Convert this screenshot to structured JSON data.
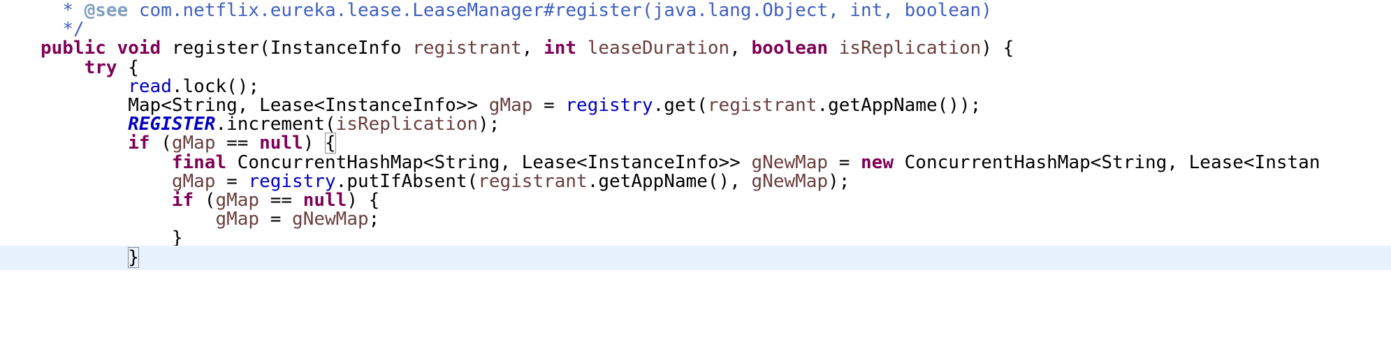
{
  "editor": {
    "lines": [
      {
        "indent": "  ",
        "highlight": false,
        "tokens": [
          {
            "t": "* ",
            "c": "cmt"
          },
          {
            "t": "@see",
            "c": "tag"
          },
          {
            "t": " com.netflix.eureka.lease.LeaseManager#register(java.lang.Object, int, boolean)",
            "c": "cmt"
          }
        ]
      },
      {
        "indent": "  ",
        "highlight": false,
        "tokens": [
          {
            "t": "*/",
            "c": "cmt"
          }
        ]
      },
      {
        "indent": "",
        "highlight": false,
        "tokens": [
          {
            "t": "public",
            "c": "kw"
          },
          {
            "t": " ",
            "c": ""
          },
          {
            "t": "void",
            "c": "kw"
          },
          {
            "t": " register(InstanceInfo ",
            "c": ""
          },
          {
            "t": "registrant",
            "c": "var"
          },
          {
            "t": ", ",
            "c": ""
          },
          {
            "t": "int",
            "c": "kw"
          },
          {
            "t": " ",
            "c": ""
          },
          {
            "t": "leaseDuration",
            "c": "var"
          },
          {
            "t": ", ",
            "c": ""
          },
          {
            "t": "boolean",
            "c": "kw"
          },
          {
            "t": " ",
            "c": ""
          },
          {
            "t": "isReplication",
            "c": "var"
          },
          {
            "t": ") {",
            "c": ""
          }
        ]
      },
      {
        "indent": "    ",
        "highlight": false,
        "tokens": [
          {
            "t": "try",
            "c": "kw"
          },
          {
            "t": " {",
            "c": ""
          }
        ]
      },
      {
        "indent": "        ",
        "highlight": false,
        "tokens": [
          {
            "t": "read",
            "c": "fld"
          },
          {
            "t": ".lock();",
            "c": ""
          }
        ]
      },
      {
        "indent": "        ",
        "highlight": false,
        "tokens": [
          {
            "t": "Map<String, Lease<InstanceInfo>> ",
            "c": ""
          },
          {
            "t": "gMap",
            "c": "var"
          },
          {
            "t": " = ",
            "c": ""
          },
          {
            "t": "registry",
            "c": "fld"
          },
          {
            "t": ".get(",
            "c": ""
          },
          {
            "t": "registrant",
            "c": "var"
          },
          {
            "t": ".getAppName());",
            "c": ""
          }
        ]
      },
      {
        "indent": "        ",
        "highlight": false,
        "tokens": [
          {
            "t": "REGISTER",
            "c": "sfld"
          },
          {
            "t": ".increment(",
            "c": ""
          },
          {
            "t": "isReplication",
            "c": "var"
          },
          {
            "t": ");",
            "c": ""
          }
        ]
      },
      {
        "indent": "        ",
        "highlight": false,
        "tokens": [
          {
            "t": "if",
            "c": "kw"
          },
          {
            "t": " (",
            "c": ""
          },
          {
            "t": "gMap",
            "c": "var"
          },
          {
            "t": " == ",
            "c": ""
          },
          {
            "t": "null",
            "c": "kw"
          },
          {
            "t": ") ",
            "c": ""
          },
          {
            "t": "{",
            "c": "bracket"
          }
        ]
      },
      {
        "indent": "            ",
        "highlight": false,
        "tokens": [
          {
            "t": "final",
            "c": "kw"
          },
          {
            "t": " ConcurrentHashMap<String, Lease<InstanceInfo>> ",
            "c": ""
          },
          {
            "t": "gNewMap",
            "c": "var"
          },
          {
            "t": " = ",
            "c": ""
          },
          {
            "t": "new",
            "c": "kw"
          },
          {
            "t": " ConcurrentHashMap<String, Lease<Instan",
            "c": ""
          }
        ]
      },
      {
        "indent": "            ",
        "highlight": false,
        "tokens": [
          {
            "t": "gMap",
            "c": "var"
          },
          {
            "t": " = ",
            "c": ""
          },
          {
            "t": "registry",
            "c": "fld"
          },
          {
            "t": ".putIfAbsent(",
            "c": ""
          },
          {
            "t": "registrant",
            "c": "var"
          },
          {
            "t": ".getAppName(), ",
            "c": ""
          },
          {
            "t": "gNewMap",
            "c": "var"
          },
          {
            "t": ");",
            "c": ""
          }
        ]
      },
      {
        "indent": "            ",
        "highlight": false,
        "tokens": [
          {
            "t": "if",
            "c": "kw"
          },
          {
            "t": " (",
            "c": ""
          },
          {
            "t": "gMap",
            "c": "var"
          },
          {
            "t": " == ",
            "c": ""
          },
          {
            "t": "null",
            "c": "kw"
          },
          {
            "t": ") {",
            "c": ""
          }
        ]
      },
      {
        "indent": "                ",
        "highlight": false,
        "tokens": [
          {
            "t": "gMap",
            "c": "var"
          },
          {
            "t": " = ",
            "c": ""
          },
          {
            "t": "gNewMap",
            "c": "var"
          },
          {
            "t": ";",
            "c": ""
          }
        ]
      },
      {
        "indent": "            ",
        "highlight": false,
        "tokens": [
          {
            "t": "}",
            "c": ""
          }
        ]
      },
      {
        "indent": "        ",
        "highlight": true,
        "tokens": [
          {
            "t": "}",
            "c": "bracket"
          }
        ]
      }
    ]
  }
}
